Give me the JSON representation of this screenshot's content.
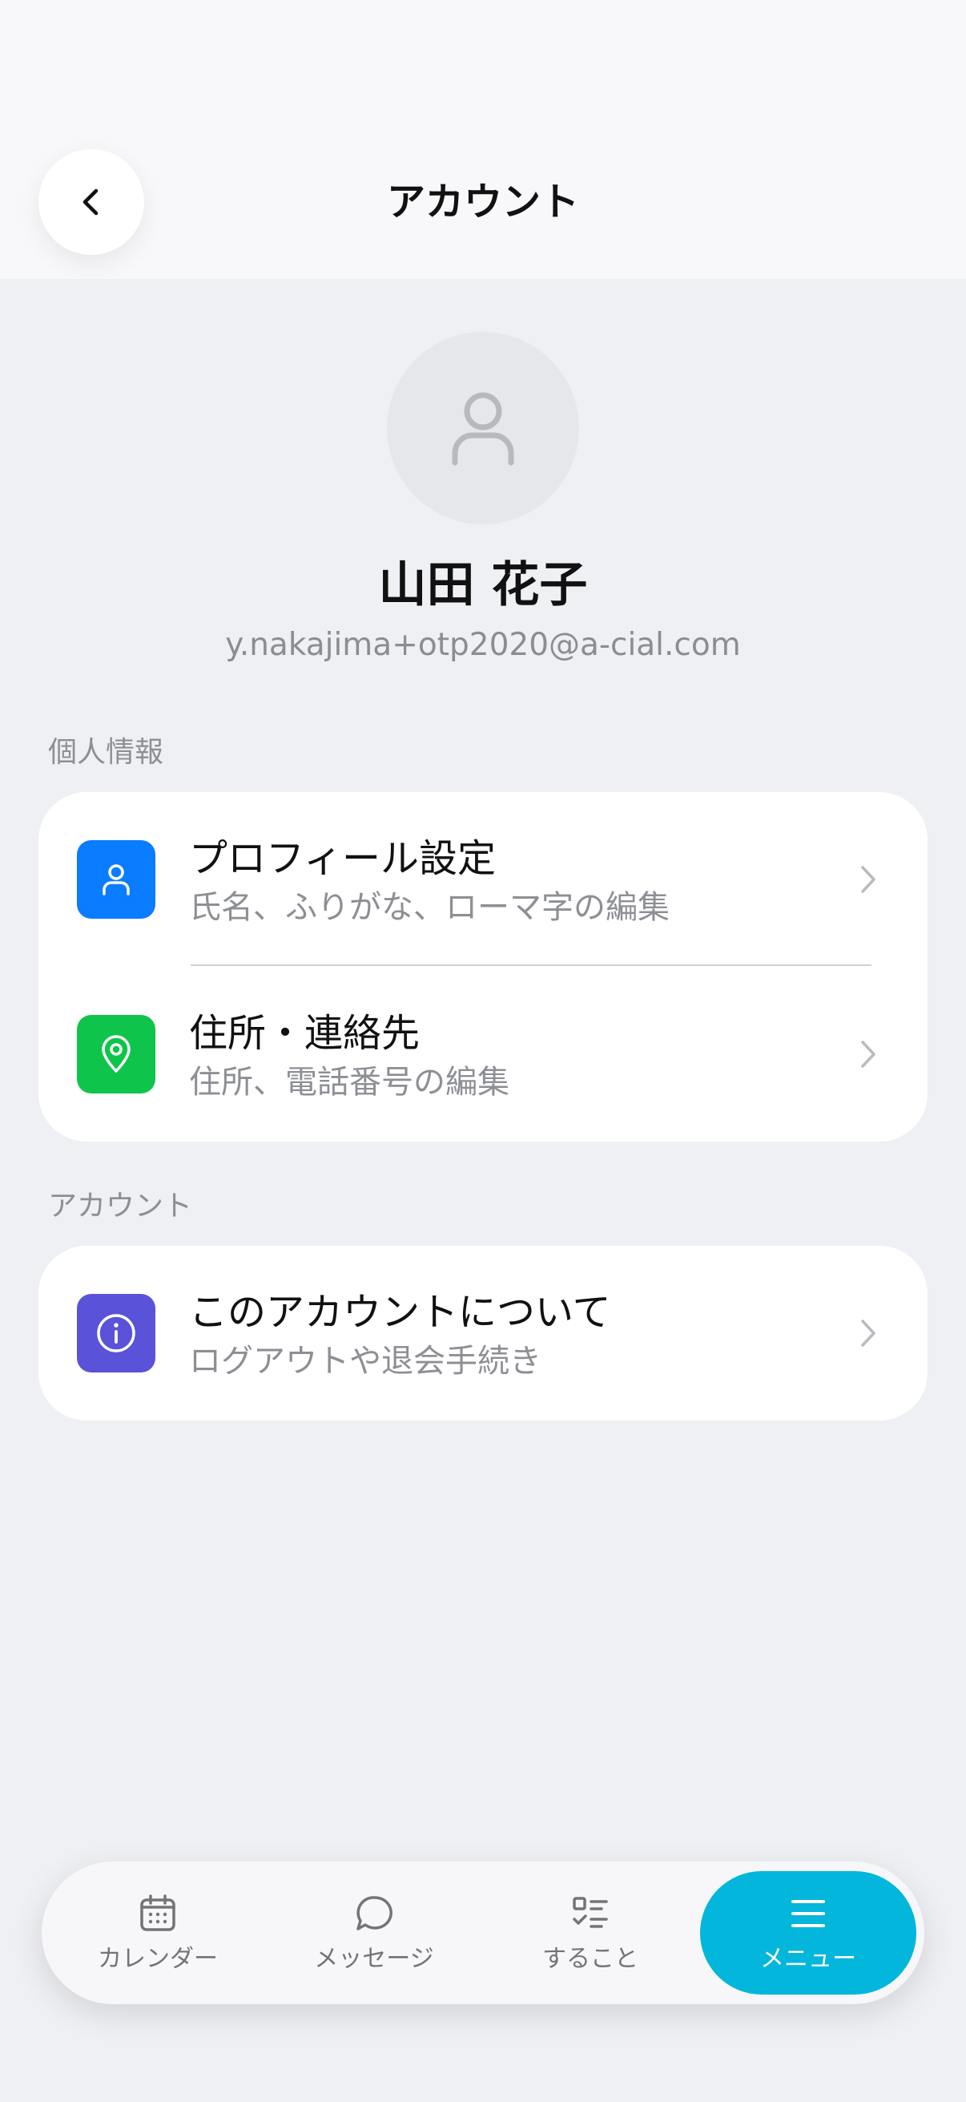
{
  "header": {
    "title": "アカウント"
  },
  "profile": {
    "name": "山田 花子",
    "email": "y.nakajima+otp2020@a-cial.com"
  },
  "sections": {
    "personal": {
      "label": "個人情報",
      "items": [
        {
          "title": "プロフィール設定",
          "subtitle": "氏名、ふりがな、ローマ字の編集",
          "icon": "person-icon",
          "color": "#0a7cff"
        },
        {
          "title": "住所・連絡先",
          "subtitle": "住所、電話番号の編集",
          "icon": "location-pin-icon",
          "color": "#0fc44a"
        }
      ]
    },
    "account": {
      "label": "アカウント",
      "items": [
        {
          "title": "このアカウントについて",
          "subtitle": "ログアウトや退会手続き",
          "icon": "info-icon",
          "color": "#5a52d9"
        }
      ]
    }
  },
  "tabbar": {
    "active_color": "#02b6dc",
    "tabs": [
      {
        "label": "カレンダー",
        "icon": "calendar-icon"
      },
      {
        "label": "メッセージ",
        "icon": "chat-bubble-icon"
      },
      {
        "label": "すること",
        "icon": "checklist-icon"
      },
      {
        "label": "メニュー",
        "icon": "menu-icon",
        "active": true
      }
    ]
  }
}
